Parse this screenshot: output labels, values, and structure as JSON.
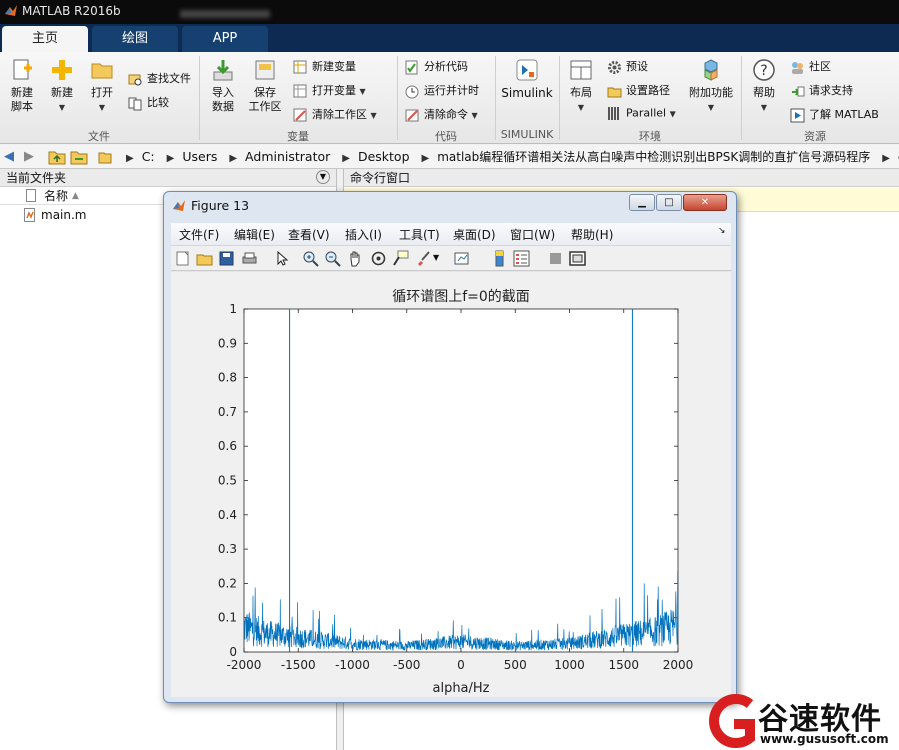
{
  "window": {
    "title": "MATLAB R2016b"
  },
  "tabs": [
    {
      "label": "主页",
      "active": true
    },
    {
      "label": "绘图",
      "active": false
    },
    {
      "label": "APP",
      "active": false
    }
  ],
  "ribbon": {
    "file": {
      "section": "文件",
      "new_script": "新建\n脚本",
      "new": "新建",
      "open": "打开",
      "find_files": "查找文件",
      "compare": "比较"
    },
    "variable": {
      "section": "变量",
      "import": "导入\n数据",
      "save_workspace": "保存\n工作区",
      "new_variable": "新建变量",
      "open_variable": "打开变量",
      "clear_workspace": "清除工作区"
    },
    "code": {
      "section": "代码",
      "analyze": "分析代码",
      "run_time": "运行并计时",
      "clear_commands": "清除命令"
    },
    "simulink": {
      "section": "SIMULINK",
      "label": "Simulink"
    },
    "environment": {
      "section": "环境",
      "layout": "布局",
      "preferences": "预设",
      "set_path": "设置路径",
      "parallel": "Parallel",
      "addons": "附加功能"
    },
    "resources": {
      "section": "资源",
      "help": "帮助",
      "community": "社区",
      "request_support": "请求支持",
      "learn_matlab": "了解 MATLAB"
    }
  },
  "address_bar": {
    "crumbs": [
      "C:",
      "Users",
      "Administrator",
      "Desktop",
      "matlab编程循环谱相关法从高白噪声中检测识别出BPSK调制的直扩信号源码程序",
      "code"
    ]
  },
  "current_folder": {
    "title": "当前文件夹",
    "column_name": "名称",
    "files": [
      "main.m"
    ]
  },
  "command_window": {
    "title": "命令行窗口"
  },
  "figure": {
    "title": "Figure 13",
    "menus": [
      "文件(F)",
      "编辑(E)",
      "查看(V)",
      "插入(I)",
      "工具(T)",
      "桌面(D)",
      "窗口(W)",
      "帮助(H)"
    ]
  },
  "chart_data": {
    "type": "line",
    "title": "循环谱图上f=0的截面",
    "xlabel": "alpha/Hz",
    "ylabel": "",
    "xlim": [
      -2000,
      2000
    ],
    "ylim": [
      0,
      1
    ],
    "xticks": [
      -2000,
      -1500,
      -1000,
      -500,
      0,
      500,
      1000,
      1500,
      2000
    ],
    "yticks": [
      0,
      0.1,
      0.2,
      0.3,
      0.4,
      0.5,
      0.6,
      0.7,
      0.8,
      0.9,
      1
    ],
    "line_color": "#0072bd",
    "peaks": [
      {
        "x": -1580,
        "y": 1.0
      },
      {
        "x": 1580,
        "y": 1.0
      }
    ],
    "noise_envelope": [
      {
        "x": -2000,
        "y": 0.12
      },
      {
        "x": -1800,
        "y": 0.09
      },
      {
        "x": -1500,
        "y": 0.07
      },
      {
        "x": -1000,
        "y": 0.04
      },
      {
        "x": -500,
        "y": 0.03
      },
      {
        "x": 0,
        "y": 0.05
      },
      {
        "x": 500,
        "y": 0.03
      },
      {
        "x": 1000,
        "y": 0.04
      },
      {
        "x": 1500,
        "y": 0.08
      },
      {
        "x": 1800,
        "y": 0.1
      },
      {
        "x": 2000,
        "y": 0.13
      }
    ]
  },
  "watermark": {
    "brand": "谷速软件",
    "url": "www.gususoft.com"
  }
}
